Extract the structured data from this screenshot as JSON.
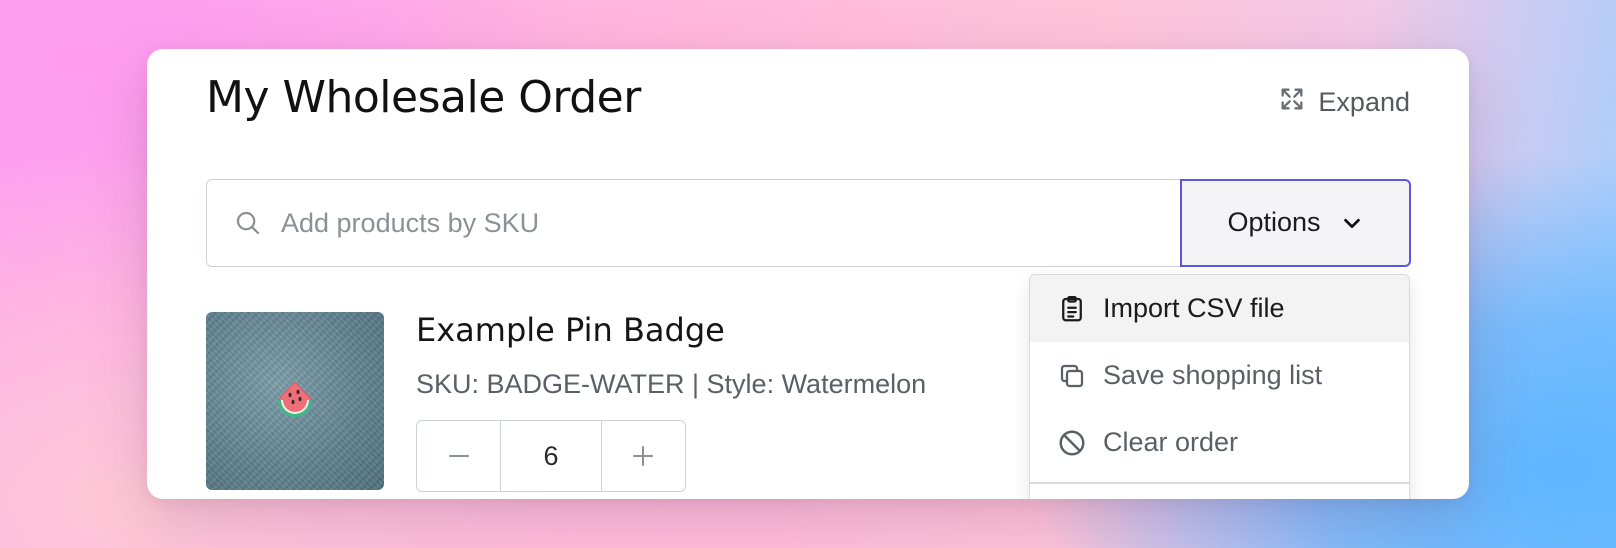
{
  "header": {
    "title": "My Wholesale Order",
    "expand_label": "Expand"
  },
  "search": {
    "placeholder": "Add products by SKU",
    "value": ""
  },
  "options_button": {
    "label": "Options"
  },
  "options_menu": {
    "items": [
      {
        "label": "Import CSV file",
        "icon": "clipboard-icon",
        "highlighted": true
      },
      {
        "label": "Save shopping list",
        "icon": "copy-icon",
        "highlighted": false
      },
      {
        "label": "Clear order",
        "icon": "block-icon",
        "highlighted": false
      }
    ]
  },
  "product": {
    "name": "Example Pin Badge",
    "meta": "SKU: BADGE-WATER | Style: Watermelon",
    "quantity": "6",
    "image_icon": "watermelon-badge"
  },
  "colors": {
    "accent": "#5c55e8",
    "text_primary": "#111111",
    "text_secondary": "#5b6066"
  }
}
